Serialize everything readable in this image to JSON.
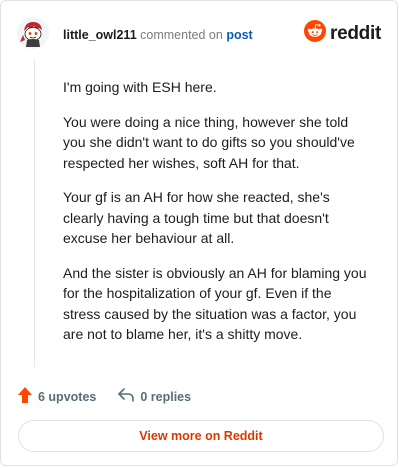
{
  "header": {
    "username": "little_owl211",
    "action_text": "commented on",
    "post_link": "post",
    "brand_name": "reddit",
    "avatar_icon": "snoo-avatar-icon",
    "brand_icon": "reddit-logo-icon"
  },
  "comment": {
    "paragraphs": [
      "I'm going with ESH here.",
      "You were doing a nice thing, however she told you she didn't want to do gifts so you should've respected her wishes, soft AH for that.",
      "Your gf is an AH for how she reacted, she's clearly having a tough time but that doesn't excuse her behaviour at all.",
      "And the sister is obviously an AH for blaming you for the hospitalization of your gf. Even if the stress caused by the situation was a factor, you are not to blame her, it's a shitty move."
    ]
  },
  "actions": {
    "upvotes_label": "6 upvotes",
    "replies_label": "0 replies",
    "upvote_icon": "upvote-arrow-icon",
    "reply_icon": "reply-arrow-icon"
  },
  "footer": {
    "view_more_label": "View more on Reddit"
  },
  "colors": {
    "accent": "#ff4500",
    "link": "#0b5bb5",
    "muted": "#576f76",
    "view_more_text": "#d93900"
  }
}
